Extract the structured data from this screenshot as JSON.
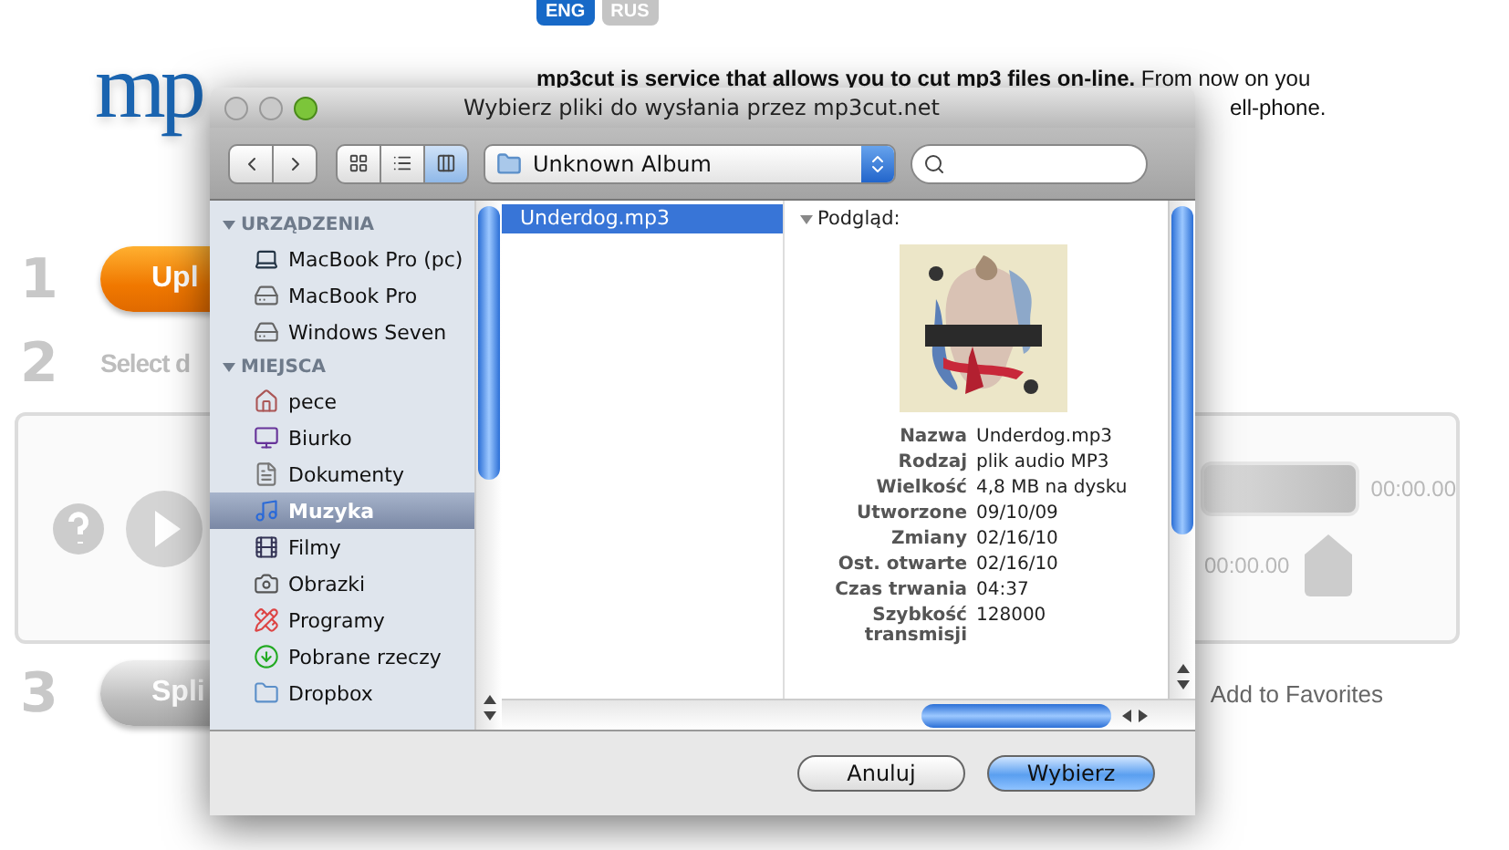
{
  "lang_switch": [
    {
      "label": "ENG",
      "selected": true
    },
    {
      "label": "RUS",
      "selected": false
    }
  ],
  "logo": {
    "text": "mp"
  },
  "intro": {
    "text": "**mp3cut is service that allows you to cut mp3 files on-line.** From now on you",
    "tail": "ell-phone."
  },
  "steps": [
    {
      "number": "1",
      "kind": "upload",
      "label": "Upl"
    },
    {
      "number": "2",
      "kind": "select",
      "label": "Select d"
    },
    {
      "number": "3",
      "kind": "split",
      "label": "Spli"
    }
  ],
  "editor": {
    "end_time": "00:00.00",
    "start_time": "00:00.00"
  },
  "favorites": "Add to Favorites",
  "dialog": {
    "title": "Wybierz pliki do wysłania przez mp3cut.net",
    "view_modes": [
      {
        "kind": "icons",
        "selected": false
      },
      {
        "kind": "list",
        "selected": false
      },
      {
        "kind": "columns",
        "selected": true
      }
    ],
    "location": "Unknown Album",
    "sidebar": [
      {
        "heading": "URZĄDZENIA",
        "expanded": true,
        "items": [
          {
            "label": "MacBook Pro (pc)",
            "kind": "laptop",
            "selected": false
          },
          {
            "label": "MacBook Pro",
            "kind": "drive",
            "selected": false
          },
          {
            "label": "Windows Seven",
            "kind": "drive",
            "selected": false
          }
        ]
      },
      {
        "heading": "MIEJSCA",
        "expanded": true,
        "items": [
          {
            "label": "pece",
            "kind": "home",
            "selected": false
          },
          {
            "label": "Biurko",
            "kind": "desktop",
            "selected": false
          },
          {
            "label": "Dokumenty",
            "kind": "document",
            "selected": false
          },
          {
            "label": "Muzyka",
            "kind": "music",
            "selected": true
          },
          {
            "label": "Filmy",
            "kind": "film",
            "selected": false
          },
          {
            "label": "Obrazki",
            "kind": "camera",
            "selected": false
          },
          {
            "label": "Programy",
            "kind": "apps",
            "selected": false
          },
          {
            "label": "Pobrane rzeczy",
            "kind": "download",
            "selected": false
          },
          {
            "label": "Dropbox",
            "kind": "folder",
            "selected": false
          }
        ]
      }
    ],
    "files": [
      {
        "name": "Underdog.mp3",
        "selected": true
      }
    ],
    "preview": {
      "heading": "Podgląd:",
      "info": [
        {
          "label": "Nazwa",
          "value": "Underdog.mp3"
        },
        {
          "label": "Rodzaj",
          "value": "plik audio MP3"
        },
        {
          "label": "Wielkość",
          "value": "4,8 MB na dysku"
        },
        {
          "label": "Utworzone",
          "value": "09/10/09"
        },
        {
          "label": "Zmiany",
          "value": "02/16/10"
        },
        {
          "label": "Ost. otwarte",
          "value": "02/16/10"
        },
        {
          "label": "Czas trwania",
          "value": "04:37"
        },
        {
          "label": "Szybkość transmisji",
          "value": "128000"
        }
      ]
    },
    "buttons": [
      {
        "label": "Anuluj",
        "default": false
      },
      {
        "label": "Wybierz",
        "default": true
      }
    ]
  }
}
